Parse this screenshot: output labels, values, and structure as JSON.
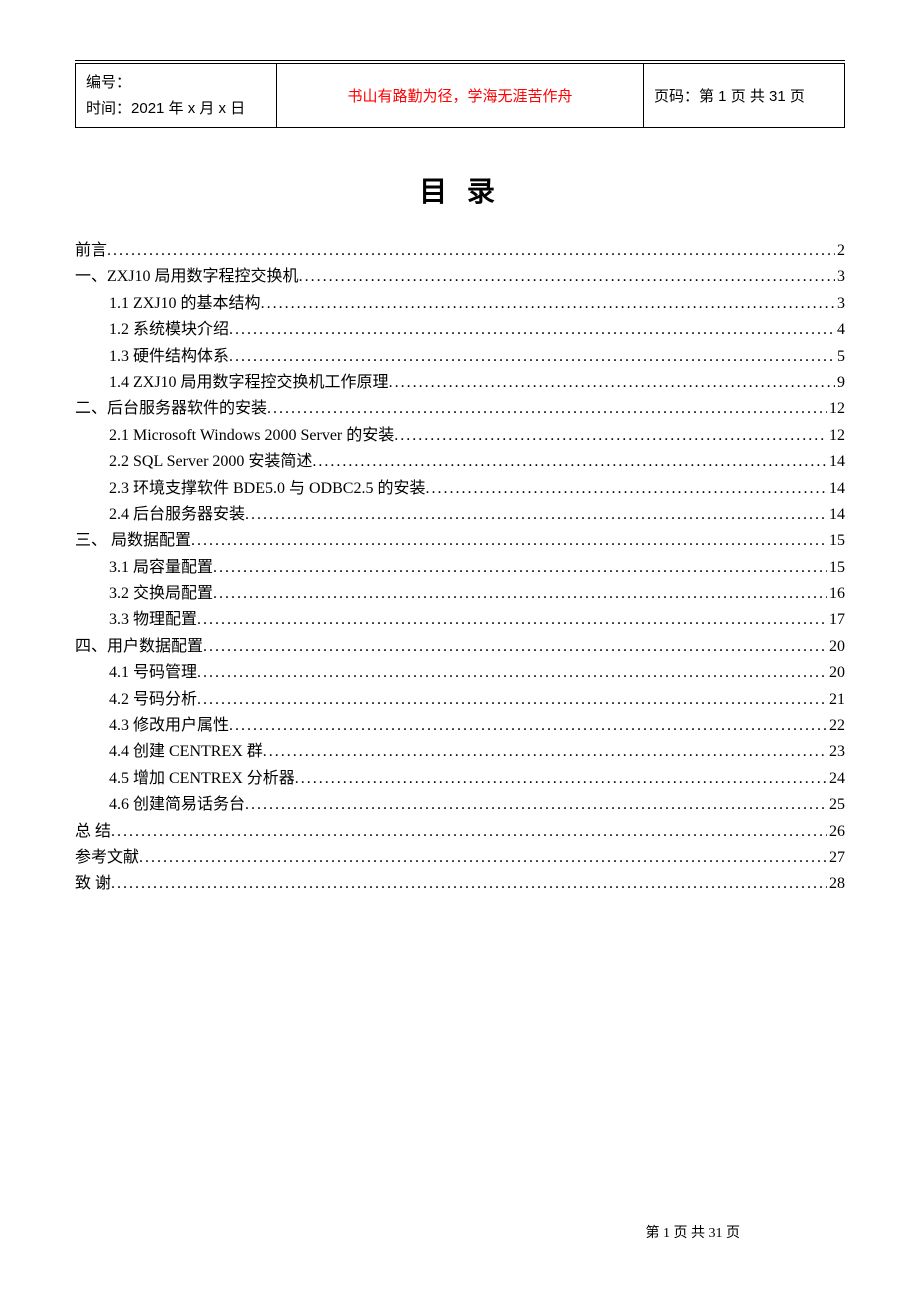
{
  "header": {
    "id_label": "编号：",
    "time_label": "时间：",
    "time_value": "2021 年 x 月 x 日",
    "motto": "书山有路勤为径，学海无涯苦作舟",
    "page_label": "页码：",
    "page_value": "第 1 页 共 31 页"
  },
  "toc_title": "目 录",
  "toc": [
    {
      "label": "前言",
      "page": "2",
      "level": 0
    },
    {
      "label": "一、ZXJ10 局用数字程控交换机 ",
      "page": "3",
      "level": 0
    },
    {
      "label": "1.1 ZXJ10 的基本结构",
      "page": "3",
      "level": 1
    },
    {
      "label": "1.2 系统模块介绍 ",
      "page": "4",
      "level": 1
    },
    {
      "label": "1.3 硬件结构体系",
      "page": "5",
      "level": 1
    },
    {
      "label": "1.4 ZXJ10 局用数字程控交换机工作原理",
      "page": "9",
      "level": 1
    },
    {
      "label": "二、后台服务器软件的安装",
      "page": "12",
      "level": 0
    },
    {
      "label": "2.1 Microsoft Windows 2000 Server 的安装 ",
      "page": "12",
      "level": 1
    },
    {
      "label": "2.2 SQL Server 2000 安装简述",
      "page": "14",
      "level": 1
    },
    {
      "label": "2.3 环境支撑软件 BDE5.0 与 ODBC2.5 的安装 ",
      "page": "14",
      "level": 1
    },
    {
      "label": "2.4 后台服务器安装",
      "page": "14",
      "level": 1
    },
    {
      "label": "三、 局数据配置",
      "page": "15",
      "level": 0
    },
    {
      "label": "3.1 局容量配置",
      "page": "15",
      "level": 1
    },
    {
      "label": "3.2 交换局配置",
      "page": "16",
      "level": 1
    },
    {
      "label": "3.3 物理配置",
      "page": "17",
      "level": 1
    },
    {
      "label": "四、用户数据配置",
      "page": "20",
      "level": 0
    },
    {
      "label": "4.1 号码管理",
      "page": "20",
      "level": 1
    },
    {
      "label": "4.2 号码分析",
      "page": "21",
      "level": 1
    },
    {
      "label": "4.3 修改用户属性",
      "page": "22",
      "level": 1
    },
    {
      "label": "4.4 创建 CENTREX 群 ",
      "page": "23",
      "level": 1
    },
    {
      "label": "4.5 增加 CENTREX 分析器 ",
      "page": "24",
      "level": 1
    },
    {
      "label": "4.6 创建简易话务台 ",
      "page": "25",
      "level": 1
    },
    {
      "label": "总 结",
      "page": "26",
      "level": 0
    },
    {
      "label": "参考文献",
      "page": "27",
      "level": 0
    },
    {
      "label": "致 谢",
      "page": "28",
      "level": 0
    }
  ],
  "footer": "第 1 页 共 31 页"
}
